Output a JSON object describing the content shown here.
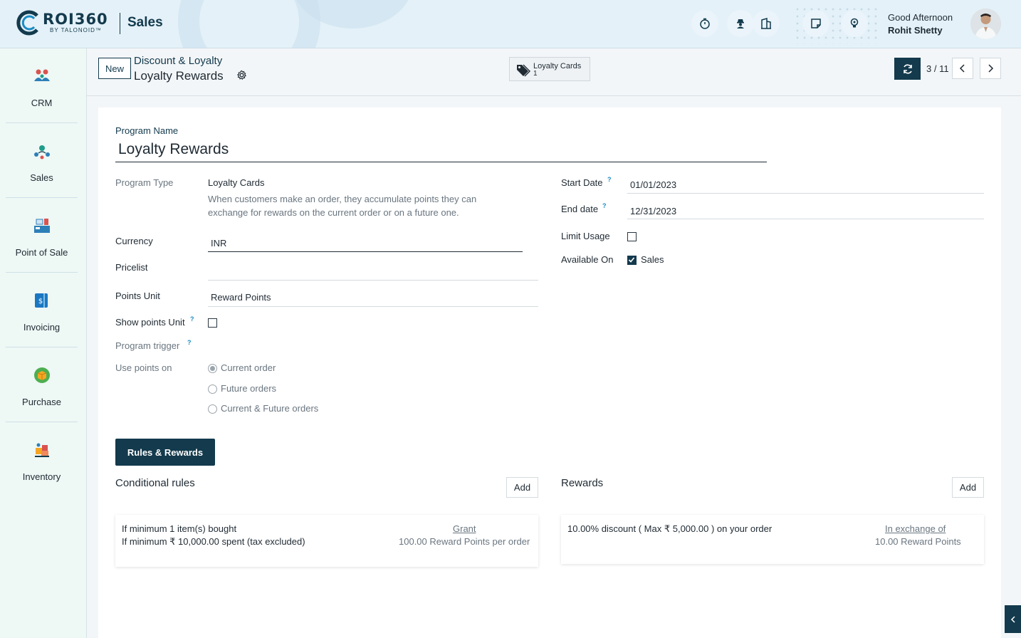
{
  "header": {
    "brand_name": "ROI360",
    "brand_sub": "BY TALONOID™",
    "app_title": "Sales",
    "greeting": "Good Afternoon",
    "user_name": "Rohit Shetty"
  },
  "sidebar": {
    "items": [
      {
        "label": "CRM",
        "icon": "people-icon"
      },
      {
        "label": "Sales",
        "icon": "network-icon"
      },
      {
        "label": "Point of Sale",
        "icon": "store-icon"
      },
      {
        "label": "Invoicing",
        "icon": "invoice-icon"
      },
      {
        "label": "Purchase",
        "icon": "box-icon"
      },
      {
        "label": "Inventory",
        "icon": "warehouse-icon"
      }
    ]
  },
  "control_panel": {
    "new_label": "New",
    "breadcrumb_parent": "Discount & Loyalty",
    "breadcrumb_current": "Loyalty Rewards",
    "smart_button_title": "Loyalty Cards",
    "smart_button_count": "1",
    "pager": "3 / 11"
  },
  "form": {
    "program_name_label": "Program Name",
    "program_name": "Loyalty Rewards",
    "program_type_label": "Program Type",
    "program_type": "Loyalty Cards",
    "program_type_desc_1": "When customers make an order, they accumulate points they can",
    "program_type_desc_2": "exchange for rewards on the current order or on a future one.",
    "currency_label": "Currency",
    "currency": "INR",
    "pricelist_label": "Pricelist",
    "pricelist": "",
    "points_unit_label": "Points Unit",
    "points_unit": "Reward Points",
    "show_points_unit_label": "Show points Unit",
    "show_points_unit": false,
    "program_trigger_label": "Program trigger",
    "use_points_on_label": "Use points on",
    "use_points_options": [
      "Current order",
      "Future orders",
      "Current & Future orders"
    ],
    "use_points_selected": "Current order",
    "start_date_label": "Start Date",
    "start_date": "01/01/2023",
    "end_date_label": "End date",
    "end_date": "12/31/2023",
    "limit_usage_label": "Limit Usage",
    "limit_usage": false,
    "available_on_label": "Available On",
    "available_on_sales": "Sales",
    "help_mark": "?"
  },
  "tabs": {
    "active": "Rules & Rewards"
  },
  "rules": {
    "title": "Conditional rules",
    "add_label": "Add",
    "line1": "If minimum 1 item(s) bought",
    "line2": "If minimum ₹ 10,000.00 spent (tax excluded)",
    "grant_label": "Grant",
    "grant_value": "100.00 Reward Points per order"
  },
  "rewards": {
    "title": "Rewards",
    "add_label": "Add",
    "line1": "10.00% discount ( Max ₹ 5,000.00 ) on your order",
    "exchange_label": "In exchange of",
    "exchange_value": "10.00 Reward Points"
  },
  "colors": {
    "primary": "#133a4d",
    "help": "#1a8cc4"
  }
}
